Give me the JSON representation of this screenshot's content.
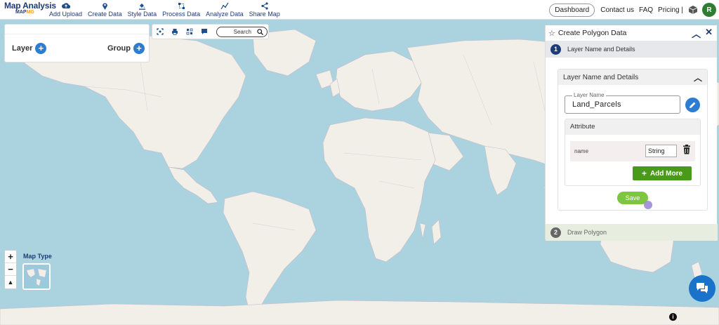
{
  "brand": {
    "title": "Map Analysis",
    "subtitle_prefix": "MAP",
    "subtitle_suffix": "MG"
  },
  "nav": [
    {
      "label": "Add Upload",
      "icon": "cloud-upload-icon"
    },
    {
      "label": "Create Data",
      "icon": "map-pin-icon"
    },
    {
      "label": "Style Data",
      "icon": "paint-bucket-icon"
    },
    {
      "label": "Process Data",
      "icon": "process-icon"
    },
    {
      "label": "Analyze Data",
      "icon": "analyze-icon"
    },
    {
      "label": "Share Map",
      "icon": "share-icon"
    }
  ],
  "header_right": {
    "dashboard": "Dashboard",
    "contact": "Contact us",
    "faq": "FAQ",
    "pricing": "Pricing |",
    "avatar_initial": "R"
  },
  "layer_panel": {
    "layer_label": "Layer",
    "group_label": "Group"
  },
  "toolbar": {
    "search_placeholder": "Search"
  },
  "map_controls": {
    "zoom_in": "+",
    "zoom_out": "−",
    "reset": "▲",
    "map_type_label": "Map Type"
  },
  "polygon_panel": {
    "title": "Create Polygon Data",
    "step1": {
      "number": "1",
      "label": "Layer Name and Details"
    },
    "section_title": "Layer Name and Details",
    "layer_name_label": "Layer Name",
    "layer_name_value": "Land_Parcels",
    "attribute_title": "Attribute",
    "attributes": [
      {
        "name": "name",
        "type": "String"
      }
    ],
    "add_more": "Add More",
    "save": "Save",
    "step2": {
      "number": "2",
      "label": "Draw Polygon"
    }
  },
  "colors": {
    "accent": "#2d7dd2",
    "brand": "#1f3b73",
    "green": "#4a9a19",
    "save_green": "#7cc642",
    "water": "#aad3df",
    "land": "#f2efe9"
  }
}
